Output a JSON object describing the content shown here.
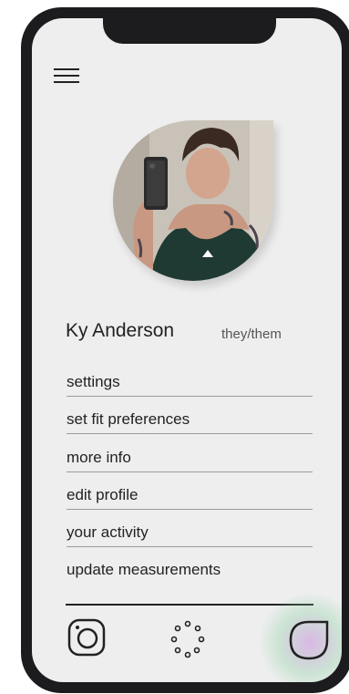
{
  "profile": {
    "name": "Ky Anderson",
    "pronouns": "they/them"
  },
  "menu": {
    "items": [
      {
        "label": "settings"
      },
      {
        "label": "set fit preferences"
      },
      {
        "label": "more info"
      },
      {
        "label": "edit profile"
      },
      {
        "label": "your activity"
      },
      {
        "label": "update measurements"
      }
    ]
  },
  "icons": {
    "menu": "hamburger-menu-icon",
    "tab1": "instagram-icon",
    "tab2": "loading-dots-icon",
    "tab3": "leaf-icon"
  },
  "colors": {
    "screen_bg": "#eeeeef",
    "phone_frame": "#1c1c1e",
    "text": "#222222",
    "divider": "#9a9a9a"
  }
}
